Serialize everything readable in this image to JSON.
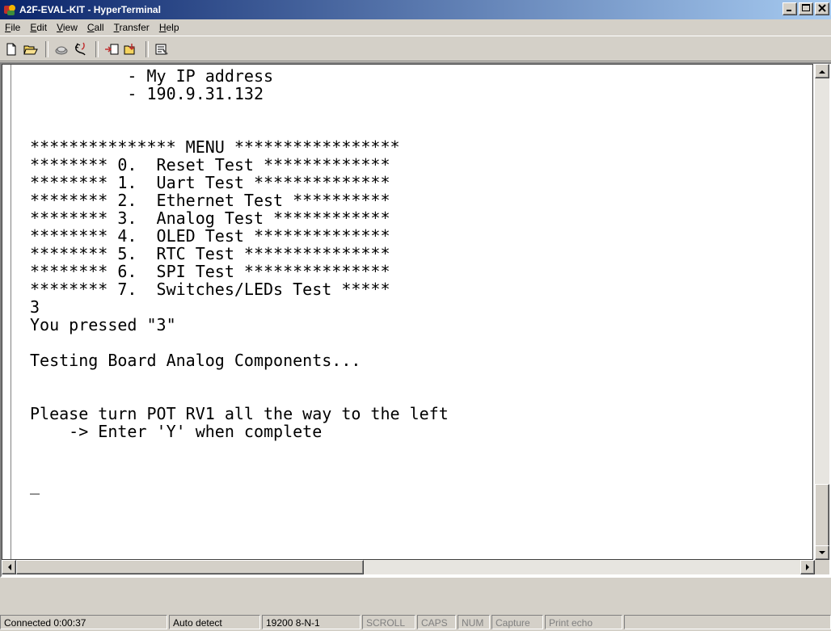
{
  "window": {
    "title": "A2F-EVAL-KIT - HyperTerminal"
  },
  "menu": [
    {
      "label": "File",
      "accel": "F",
      "rest": "ile"
    },
    {
      "label": "Edit",
      "accel": "E",
      "rest": "dit"
    },
    {
      "label": "View",
      "accel": "V",
      "rest": "iew"
    },
    {
      "label": "Call",
      "accel": "C",
      "rest": "all"
    },
    {
      "label": "Transfer",
      "accel": "T",
      "rest": "ransfer"
    },
    {
      "label": "Help",
      "accel": "H",
      "rest": "elp"
    }
  ],
  "toolbar": [
    "new-connection-icon",
    "open-icon",
    "disconnect-icon",
    "call-icon",
    "send-icon",
    "receive-icon",
    "properties-icon"
  ],
  "terminal": {
    "lines": [
      "          - My IP address",
      "          - 190.9.31.132",
      "",
      "",
      "*************** MENU *****************",
      "******** 0.  Reset Test *************",
      "******** 1.  Uart Test **************",
      "******** 2.  Ethernet Test **********",
      "******** 3.  Analog Test ************",
      "******** 4.  OLED Test **************",
      "******** 5.  RTC Test ***************",
      "******** 6.  SPI Test ***************",
      "******** 7.  Switches/LEDs Test *****",
      "3",
      "You pressed \"3\"",
      "",
      "Testing Board Analog Components...",
      "",
      "",
      "Please turn POT RV1 all the way to the left",
      "    -> Enter 'Y' when complete",
      "",
      "",
      "_"
    ]
  },
  "status": {
    "connected": "Connected 0:00:37",
    "detect": "Auto detect",
    "settings": "19200 8-N-1",
    "scroll": "SCROLL",
    "caps": "CAPS",
    "num": "NUM",
    "capture": "Capture",
    "print_echo": "Print echo"
  }
}
